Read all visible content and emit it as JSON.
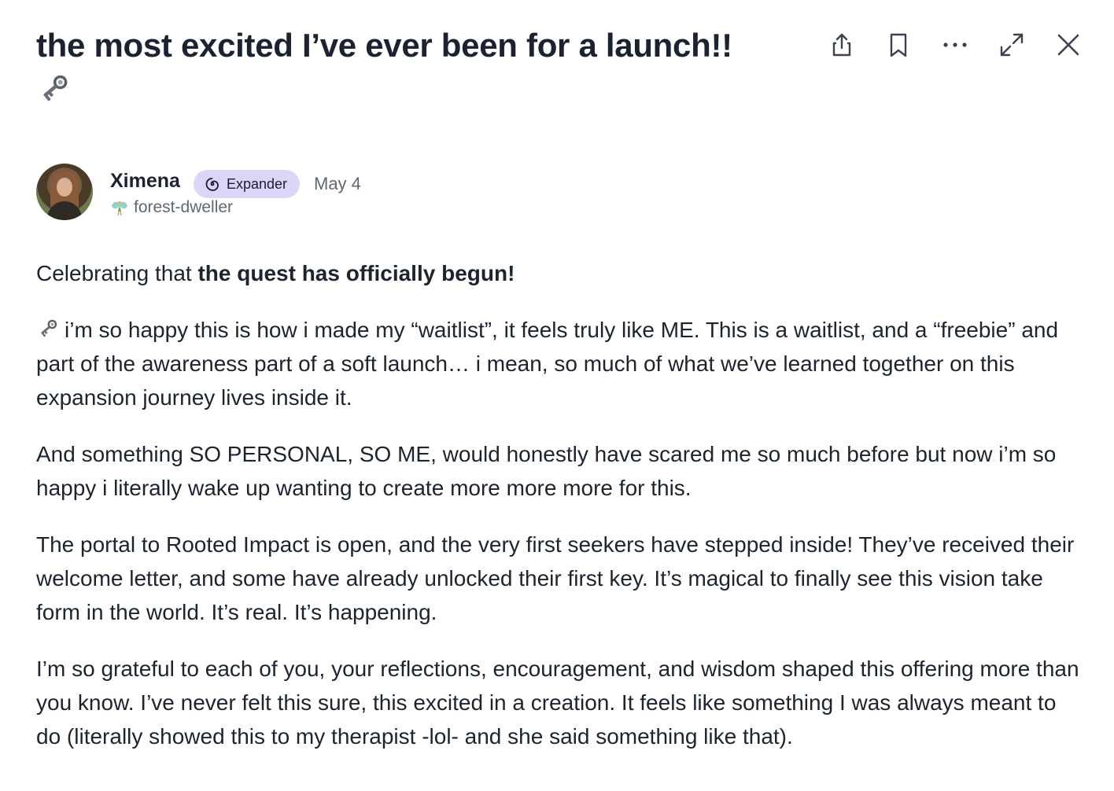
{
  "post": {
    "title": "the most excited I’ve ever been for a launch!!",
    "title_emoji": "old-key-icon",
    "actions": [
      {
        "name": "share-icon"
      },
      {
        "name": "bookmark-icon"
      },
      {
        "name": "more-icon"
      },
      {
        "name": "expand-icon"
      },
      {
        "name": "close-icon"
      }
    ],
    "author": {
      "name": "Ximena",
      "badge": "Expander",
      "badge_color": "#ddd5f8",
      "date": "May 4",
      "tagline": "forest-dweller"
    },
    "body": {
      "p1_prefix": "Celebrating that ",
      "p1_bold": "the quest has officially begun!",
      "p2": "i’m so happy this is how i made my “waitlist”, it feels truly like ME. This is a waitlist, and a “freebie” and part of the awareness part of a soft launch… i mean, so much of what we’ve learned together on this expansion journey lives inside it.",
      "p3": "And something SO PERSONAL, SO ME, would honestly have scared me so much before but now i’m so happy i literally wake up wanting to create more more more for this.",
      "p4": "The portal to Rooted Impact is open, and the very first seekers have stepped inside! They’ve received their welcome letter, and some have already unlocked their first key. It’s magical to finally see this vision take form in the world. It’s real. It’s happening.",
      "p5": "I’m so grateful to each of you, your reflections, encouragement, and wisdom shaped this offering more than you know. I’ve never felt this sure, this excited in a creation. It feels like something I was always meant to do (literally showed this to my therapist -lol- and she said something like that)."
    }
  }
}
